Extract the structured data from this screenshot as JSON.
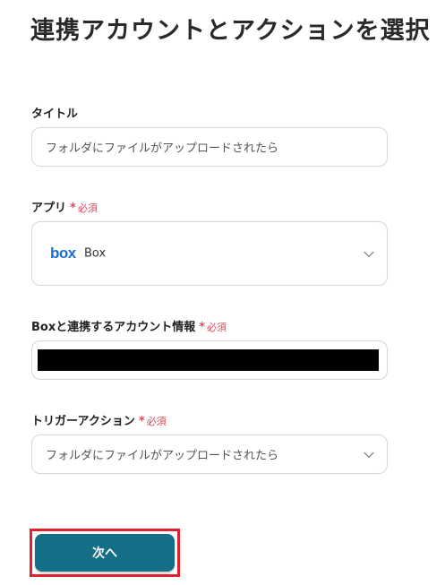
{
  "page": {
    "title": "連携アカウントとアクションを選択"
  },
  "fields": {
    "title": {
      "label": "タイトル",
      "value": "フォルダにファイルがアップロードされたら"
    },
    "app": {
      "label": "アプリ",
      "required_star": "*",
      "required_text": "必須",
      "logo_text": "box",
      "value": "Box"
    },
    "account": {
      "label": "Boxと連携するアカウント情報",
      "required_star": "*",
      "required_text": "必須"
    },
    "trigger": {
      "label": "トリガーアクション",
      "required_star": "*",
      "required_text": "必須",
      "value": "フォルダにファイルがアップロードされたら"
    }
  },
  "actions": {
    "next_label": "次へ"
  },
  "colors": {
    "accent": "#136e86",
    "required": "#e0475a",
    "highlight": "#e0222e",
    "box_brand": "#1a6fd6"
  }
}
